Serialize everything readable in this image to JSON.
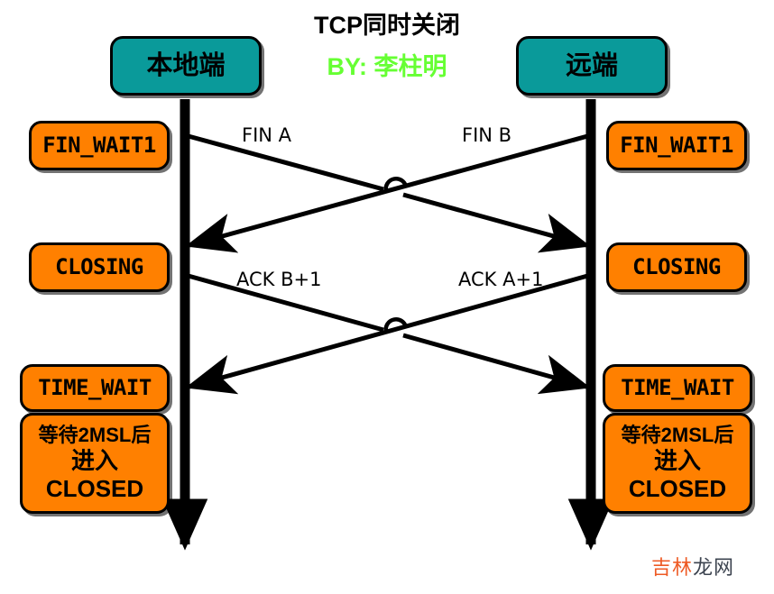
{
  "title": {
    "main": "TCP同时关闭",
    "sub": "BY: 李柱明"
  },
  "colors": {
    "endpoint_fill": "#0a9a9a",
    "state_fill": "#ff8000",
    "stroke": "#000000",
    "title_sub": "#66ff33",
    "watermark_accent": "#ee5a24",
    "watermark_dark": "#3d4450",
    "background": "#ffffff"
  },
  "endpoints": [
    {
      "id": "local",
      "label": "本地端"
    },
    {
      "id": "remote",
      "label": "远端"
    }
  ],
  "left_states": [
    {
      "id": "fin-wait1",
      "label": "FIN_WAIT1"
    },
    {
      "id": "closing",
      "label": "CLOSING"
    },
    {
      "id": "time-wait",
      "label": "TIME_WAIT"
    }
  ],
  "right_states": [
    {
      "id": "fin-wait1",
      "label": "FIN_WAIT1"
    },
    {
      "id": "closing",
      "label": "CLOSING"
    },
    {
      "id": "time-wait",
      "label": "TIME_WAIT"
    }
  ],
  "final_note": {
    "line1": "等待2MSL后",
    "line2": "进入",
    "line3": "CLOSED"
  },
  "messages": [
    {
      "id": "fin-a",
      "label": "FIN A",
      "direction": "local-to-remote"
    },
    {
      "id": "fin-b",
      "label": "FIN B",
      "direction": "remote-to-local"
    },
    {
      "id": "ack-b1",
      "label": "ACK B+1",
      "direction": "local-to-remote"
    },
    {
      "id": "ack-a1",
      "label": "ACK A+1",
      "direction": "remote-to-local"
    }
  ],
  "watermark": {
    "part1": "吉林",
    "part2": "龙网"
  }
}
